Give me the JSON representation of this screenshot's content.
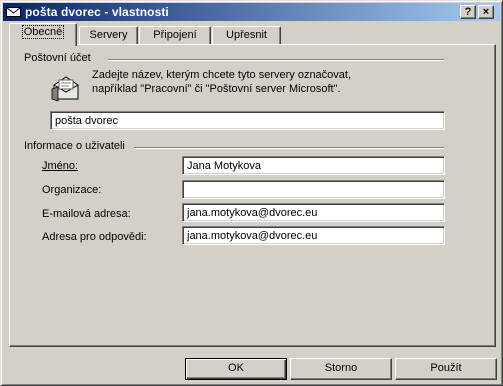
{
  "window": {
    "title": "pošta dvorec - vlastnosti"
  },
  "titlebar_buttons": {
    "help": "?",
    "close": "×"
  },
  "tabs": [
    {
      "label": "Obecné",
      "active": true
    },
    {
      "label": "Servery",
      "active": false
    },
    {
      "label": "Připojení",
      "active": false
    },
    {
      "label": "Upřesnit",
      "active": false
    }
  ],
  "mail_account": {
    "section_title": "Poštovní účet",
    "description_line1": "Zadejte název, kterým chcete tyto servery označovat,",
    "description_line2": "například \"Pracovní\" či \"Poštovní server Microsoft\".",
    "name_value": "pošta dvorec",
    "icon": "mail-account-icon"
  },
  "user_info": {
    "section_title": "Informace o uživateli",
    "fields": [
      {
        "label": "Jméno:",
        "value": "Jana Motykova"
      },
      {
        "label": "Organizace:",
        "value": ""
      },
      {
        "label": "E-mailová adresa:",
        "value": "jana.motykova@dvorec.eu"
      },
      {
        "label": "Adresa pro odpovědi:",
        "value": "jana.motykova@dvorec.eu"
      }
    ]
  },
  "buttons": {
    "ok": "OK",
    "cancel": "Storno",
    "apply": "Použít"
  },
  "colors": {
    "face": "#d4d0c8",
    "title_start": "#0a246a",
    "title_end": "#a6caf0"
  }
}
